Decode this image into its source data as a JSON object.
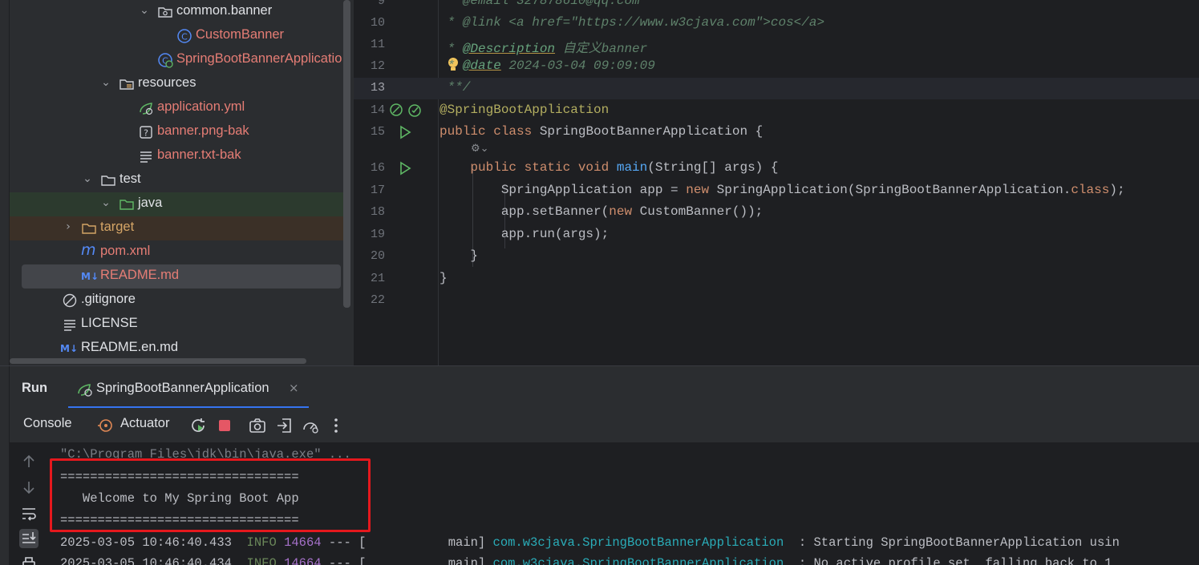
{
  "tree": {
    "items": [
      {
        "label": "common.banner",
        "icon": "folder-package-icon",
        "color": "def",
        "chevron": "down"
      },
      {
        "label": "CustomBanner",
        "icon": "class-icon",
        "color": "red",
        "chevron": ""
      },
      {
        "label": "SpringBootBannerApplicatio",
        "icon": "spring-class-icon",
        "color": "red",
        "chevron": ""
      },
      {
        "label": "resources",
        "icon": "resources-folder-icon",
        "color": "def",
        "chevron": "down"
      },
      {
        "label": "application.yml",
        "icon": "spring-config-icon",
        "color": "red",
        "chevron": ""
      },
      {
        "label": "banner.png-bak",
        "icon": "unknown-file-icon",
        "color": "red",
        "chevron": ""
      },
      {
        "label": "banner.txt-bak",
        "icon": "text-file-icon",
        "color": "red",
        "chevron": ""
      },
      {
        "label": "test",
        "icon": "folder-icon",
        "color": "def",
        "chevron": "down"
      },
      {
        "label": "java",
        "icon": "test-source-folder-icon",
        "color": "def",
        "chevron": "down"
      },
      {
        "label": "target",
        "icon": "excluded-folder-icon",
        "color": "yel",
        "chevron": "right"
      },
      {
        "label": "pom.xml",
        "icon": "maven-icon",
        "color": "red",
        "chevron": ""
      },
      {
        "label": "README.md",
        "icon": "markdown-icon",
        "color": "red",
        "chevron": ""
      },
      {
        "label": ".gitignore",
        "icon": "ignore-file-icon",
        "color": "def",
        "chevron": ""
      },
      {
        "label": "LICENSE",
        "icon": "text-file-icon",
        "color": "def",
        "chevron": ""
      },
      {
        "label": "README.en.md",
        "icon": "markdown-icon",
        "color": "def",
        "chevron": ""
      }
    ]
  },
  "editor": {
    "lines": [
      {
        "num": "9",
        "text": " * @email 327878610@qq.com"
      },
      {
        "num": "10",
        "pre": " * @link ",
        "text": "<a href=\"https://www.w3cjava.com\">cos</a>"
      },
      {
        "num": "11",
        "tag": "@Description",
        "text": " 自定义banner"
      },
      {
        "num": "12",
        "tag": "@date",
        "text": " 2024-03-04 09:09:09"
      },
      {
        "num": "13",
        "text": " **/"
      },
      {
        "num": "14",
        "text": "@SpringBootApplication"
      },
      {
        "num": "15",
        "kw": "public class ",
        "text": "SpringBootBannerApplication {"
      },
      {
        "num": "16",
        "kw": "    public static void ",
        "fn": "main",
        "text": "(String[] args) {"
      },
      {
        "num": "17",
        "pre": "        SpringApplication app = ",
        "kw": "new ",
        "text": "SpringApplication(SpringBootBannerApplication.",
        "kw2": "class",
        "post": ");"
      },
      {
        "num": "18",
        "pre": "        app.setBanner(",
        "kw": "new ",
        "text": "CustomBanner());"
      },
      {
        "num": "19",
        "text": "        app.run(args);"
      },
      {
        "num": "20",
        "text": "    }"
      },
      {
        "num": "21",
        "text": "}"
      },
      {
        "num": "22",
        "text": ""
      }
    ]
  },
  "run": {
    "title": "Run",
    "tab_label": "SpringBootBannerApplication",
    "close_glyph": "×",
    "toolbar": {
      "console_tab": "Console",
      "actuator_tab": "Actuator"
    },
    "console": {
      "cmd": "\"C:\\Program Files\\jdk\\bin\\java.exe\" ...",
      "banner_rule1": "================================",
      "banner_text": "   Welcome to My Spring Boot App",
      "banner_rule2": "================================",
      "log1": {
        "ts": "2025-03-05 10:46:40.433",
        "level": "INFO",
        "pid": "14664",
        "sep": " --- [           main] ",
        "cls": "com.w3cjava.SpringBootBannerApplication",
        "msg": "  : Starting SpringBootBannerApplication usin"
      },
      "log2": {
        "ts": "2025-03-05 10:46:40.434",
        "level": "INFO",
        "pid": "14664",
        "sep": " --- [           main] ",
        "cls": "com.w3cjava.SpringBootBannerApplication",
        "msg": "  : No active profile set, falling back to 1"
      }
    }
  }
}
